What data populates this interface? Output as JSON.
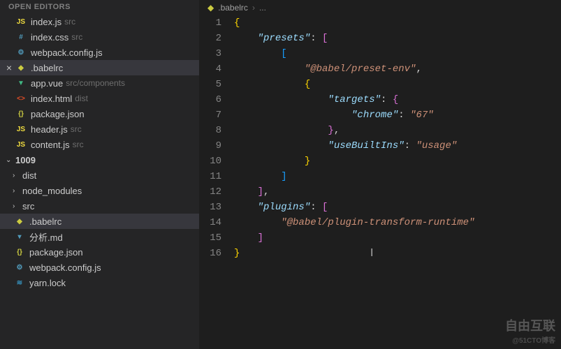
{
  "sidebar": {
    "openEditorsTitle": "OPEN EDITORS",
    "openEditors": [
      {
        "name": "index.js",
        "dir": "src",
        "icon": "js"
      },
      {
        "name": "index.css",
        "dir": "src",
        "icon": "hash"
      },
      {
        "name": "webpack.config.js",
        "dir": "",
        "icon": "gear"
      },
      {
        "name": ".babelrc",
        "dir": "",
        "icon": "babel",
        "active": true,
        "closeable": true
      },
      {
        "name": "app.vue",
        "dir": "src/components",
        "icon": "vue"
      },
      {
        "name": "index.html",
        "dir": "dist",
        "icon": "html"
      },
      {
        "name": "package.json",
        "dir": "",
        "icon": "json"
      },
      {
        "name": "header.js",
        "dir": "src",
        "icon": "js"
      },
      {
        "name": "content.js",
        "dir": "src",
        "icon": "js"
      }
    ],
    "projectName": "1009",
    "folders": [
      {
        "name": "dist"
      },
      {
        "name": "node_modules"
      },
      {
        "name": "src"
      }
    ],
    "files": [
      {
        "name": ".babelrc",
        "icon": "babel",
        "selected": true
      },
      {
        "name": "分析.md",
        "icon": "md"
      },
      {
        "name": "package.json",
        "icon": "json"
      },
      {
        "name": "webpack.config.js",
        "icon": "gear"
      },
      {
        "name": "yarn.lock",
        "icon": "yarn"
      }
    ]
  },
  "breadcrumb": {
    "file": ".babelrc",
    "rest": "..."
  },
  "code": {
    "lines": 16,
    "content": {
      "presets": [
        "@babel/preset-env",
        {
          "targets": {
            "chrome": "67"
          },
          "useBuiltIns": "usage"
        }
      ],
      "plugins": [
        "@babel/plugin-transform-runtime"
      ]
    }
  },
  "watermark": {
    "main": "自由互联",
    "sub": "@51CTO博客"
  }
}
